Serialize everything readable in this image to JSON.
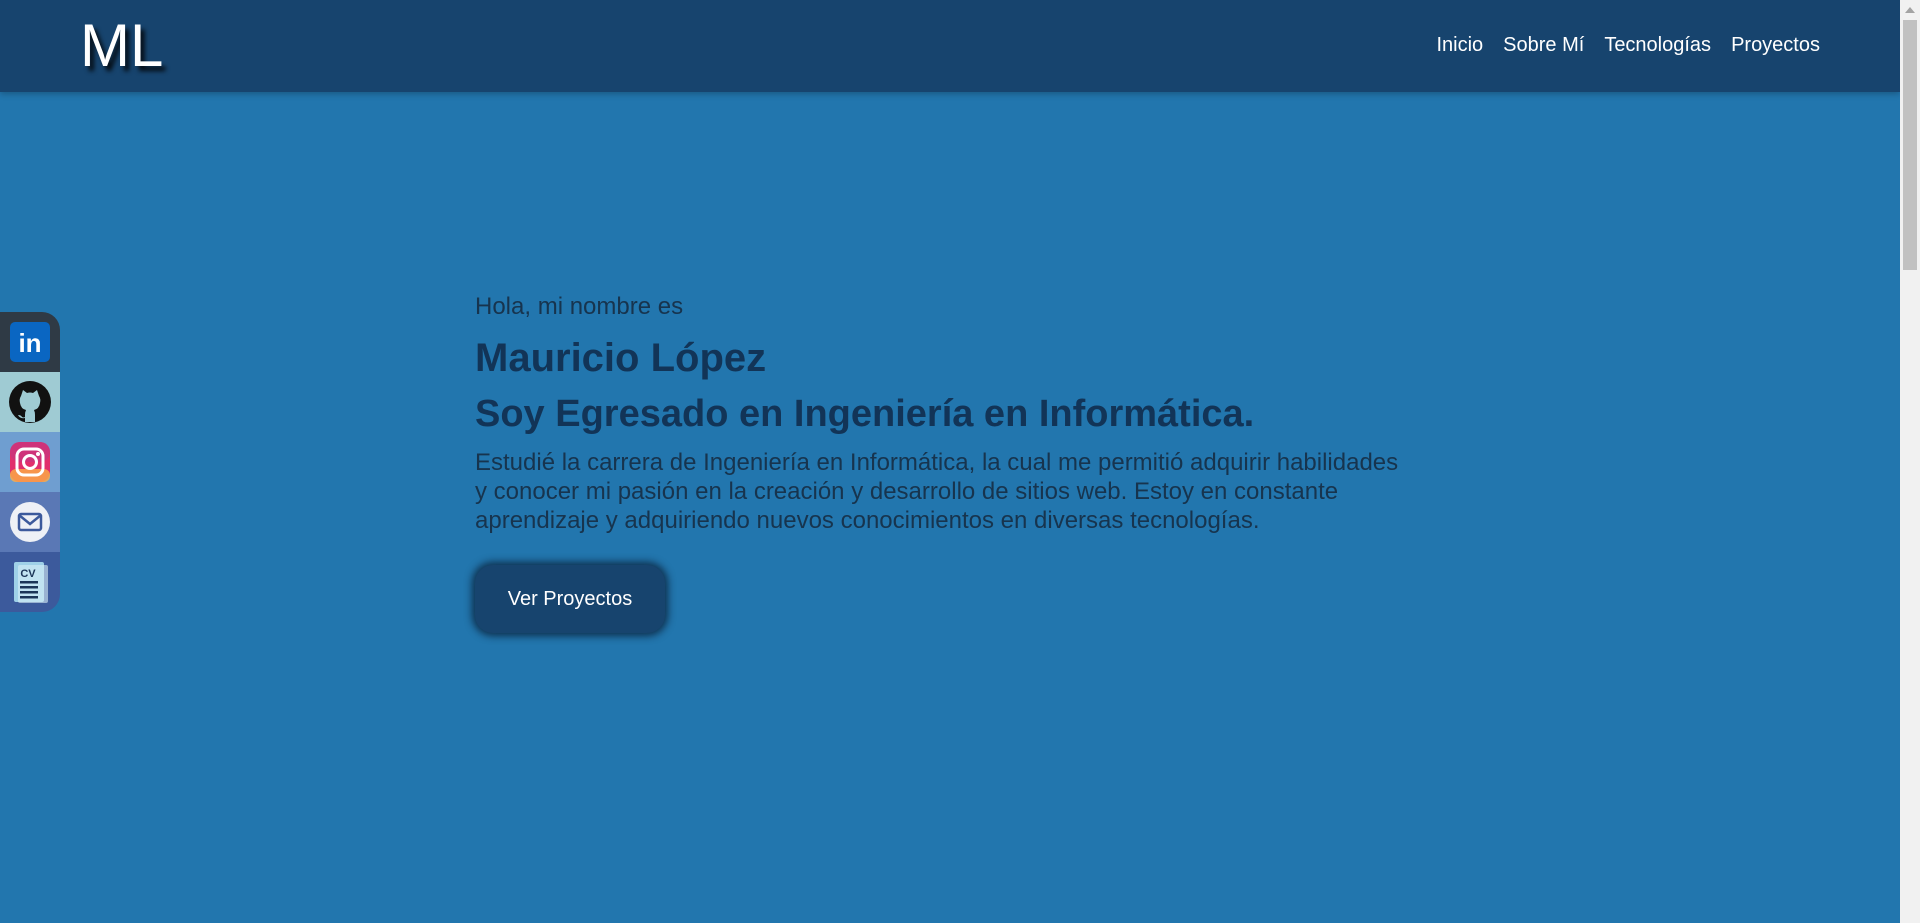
{
  "header": {
    "logo": "ML",
    "nav": [
      {
        "label": "Inicio"
      },
      {
        "label": "Sobre Mí"
      },
      {
        "label": "Tecnologías"
      },
      {
        "label": "Proyectos"
      }
    ]
  },
  "social": [
    {
      "name": "linkedin",
      "label": "in",
      "icon": "linkedin-icon",
      "bg": "#2f3a45"
    },
    {
      "name": "github",
      "label": "",
      "icon": "github-icon",
      "bg": "#9fcbd3"
    },
    {
      "name": "instagram",
      "label": "",
      "icon": "instagram-icon",
      "bg": "#6f9ed0"
    },
    {
      "name": "email",
      "label": "",
      "icon": "mail-icon",
      "bg": "#5a78b5"
    },
    {
      "name": "cv",
      "label": "CV",
      "icon": "cv-icon",
      "bg": "#3c5a9c"
    }
  ],
  "hero": {
    "greeting": "Hola, mi nombre es",
    "name": "Mauricio López",
    "role": "Soy Egresado en Ingeniería en Informática.",
    "description": "Estudié la carrera de Ingeniería en Informática, la cual me permitió adquirir habilidades y conocer mi pasión en la creación y desarrollo de sitios web. Estoy en constante aprendizaje y adquiriendo nuevos conocimientos en diversas tecnologías.",
    "cta": "Ver Proyectos"
  },
  "colors": {
    "background": "#2276ae",
    "navbar": "#17446e",
    "heading": "#123457"
  }
}
